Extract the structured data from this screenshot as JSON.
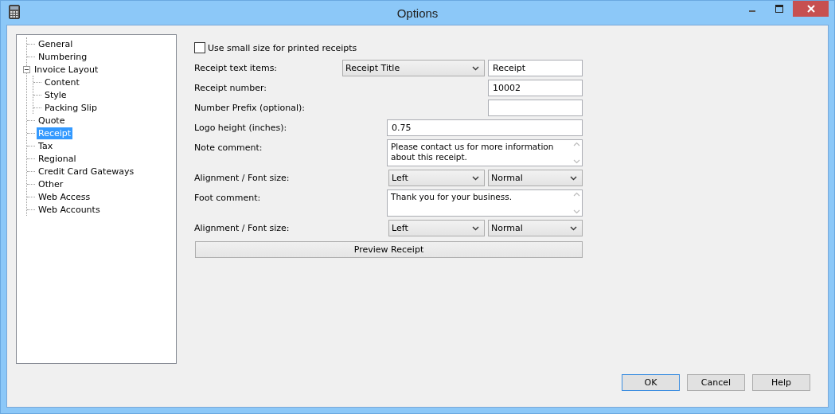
{
  "window": {
    "title": "Options"
  },
  "tree": [
    {
      "label": "General",
      "selected": false
    },
    {
      "label": "Numbering",
      "selected": false
    },
    {
      "label": "Invoice Layout",
      "selected": false,
      "expanded": true,
      "children": [
        {
          "label": "Content",
          "selected": false
        },
        {
          "label": "Style",
          "selected": false
        },
        {
          "label": "Packing Slip",
          "selected": false
        }
      ]
    },
    {
      "label": "Quote",
      "selected": false
    },
    {
      "label": "Receipt",
      "selected": true
    },
    {
      "label": "Tax",
      "selected": false
    },
    {
      "label": "Regional",
      "selected": false
    },
    {
      "label": "Credit Card Gateways",
      "selected": false
    },
    {
      "label": "Other",
      "selected": false
    },
    {
      "label": "Web Access",
      "selected": false
    },
    {
      "label": "Web Accounts",
      "selected": false
    }
  ],
  "small_size": {
    "label": "Use small size for printed receipts",
    "checked": false
  },
  "rows": [
    {
      "kind": "combo-text",
      "label": "Receipt text items:",
      "select": "Receipt Title",
      "value": "Receipt"
    },
    {
      "kind": "short-text",
      "label": "Receipt number:",
      "value": "10002"
    },
    {
      "kind": "short-text",
      "label": "Number Prefix (optional):"
    },
    {
      "kind": "wide-text",
      "label": "Logo height (inches):",
      "value": "0.75"
    },
    {
      "kind": "memo",
      "label": "Note comment:",
      "value": "Please contact us for more information about this receipt."
    },
    {
      "kind": "align",
      "label": "Alignment / Font size:",
      "alignment": "Left",
      "font_size": "Normal"
    },
    {
      "kind": "memo",
      "label": "Foot comment:",
      "value": "Thank you for your business."
    },
    {
      "kind": "align",
      "label": "Alignment / Font size:",
      "alignment": "Left",
      "font_size": "Normal"
    }
  ],
  "preview_button": "Preview Receipt",
  "buttons": [
    {
      "label": "OK",
      "default": true
    },
    {
      "label": "Cancel",
      "default": false
    },
    {
      "label": "Help",
      "default": false
    }
  ]
}
